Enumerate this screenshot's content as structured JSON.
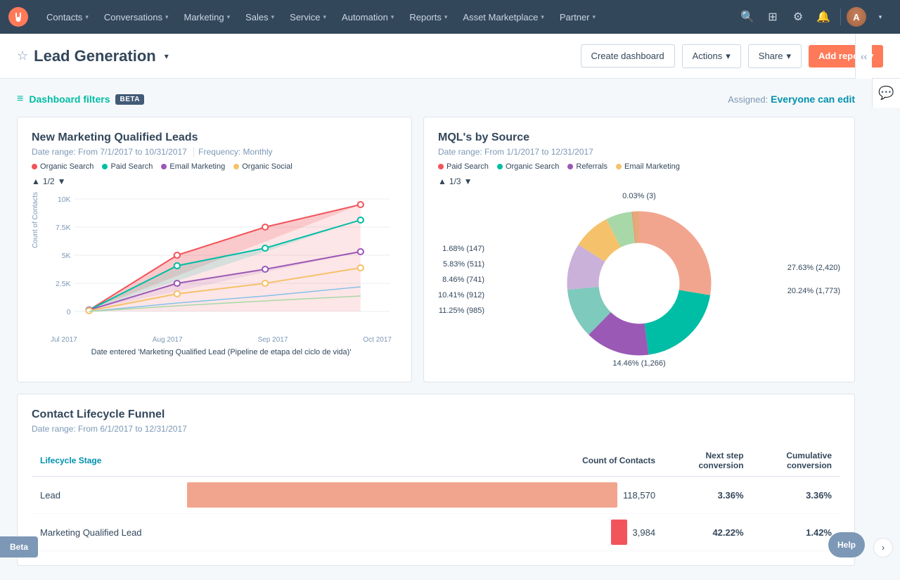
{
  "nav": {
    "logo_alt": "HubSpot",
    "items": [
      {
        "label": "Contacts",
        "id": "contacts"
      },
      {
        "label": "Conversations",
        "id": "conversations"
      },
      {
        "label": "Marketing",
        "id": "marketing"
      },
      {
        "label": "Sales",
        "id": "sales"
      },
      {
        "label": "Service",
        "id": "service"
      },
      {
        "label": "Automation",
        "id": "automation"
      },
      {
        "label": "Reports",
        "id": "reports"
      },
      {
        "label": "Asset Marketplace",
        "id": "asset-marketplace"
      },
      {
        "label": "Partner",
        "id": "partner"
      }
    ]
  },
  "header": {
    "title": "Lead Generation",
    "create_dashboard": "Create dashboard",
    "actions": "Actions",
    "share": "Share",
    "add_report": "Add report",
    "assigned_label": "Assigned:",
    "assigned_value": "Everyone can edit"
  },
  "filter_bar": {
    "label": "Dashboard filters",
    "beta": "BETA"
  },
  "chart_left": {
    "title": "New Marketing Qualified Leads",
    "date_range": "Date range: From 7/1/2017 to 10/31/2017",
    "frequency": "Frequency: Monthly",
    "y_axis_label": "Count of Contacts",
    "x_label": "Date entered 'Marketing Qualified Lead (Pipeline de etapa del ciclo de vida)'",
    "x_ticks": [
      "Jul 2017",
      "Aug 2017",
      "Sep 2017",
      "Oct 2017"
    ],
    "y_ticks": [
      "10K",
      "7.5K",
      "5K",
      "2.5K",
      "0"
    ],
    "pagination": "1/2",
    "legend": [
      {
        "label": "Organic Search",
        "color": "#f2545b"
      },
      {
        "label": "Paid Search",
        "color": "#00bda5"
      },
      {
        "label": "Email Marketing",
        "color": "#9b59b6"
      },
      {
        "label": "Organic Social",
        "color": "#f5c26b"
      }
    ]
  },
  "chart_right": {
    "title": "MQL's by Source",
    "date_range": "Date range: From 1/1/2017 to 12/31/2017",
    "pagination": "1/3",
    "legend": [
      {
        "label": "Paid Search",
        "color": "#f2545b"
      },
      {
        "label": "Organic Search",
        "color": "#00bda5"
      },
      {
        "label": "Referrals",
        "color": "#9b59b6"
      },
      {
        "label": "Email Marketing",
        "color": "#f5c26b"
      }
    ],
    "segments": [
      {
        "label": "27.63% (2,420)",
        "color": "#f2a58e",
        "position": "right-top"
      },
      {
        "label": "20.24% (1,773)",
        "color": "#00bda5",
        "position": "right-bottom"
      },
      {
        "label": "14.46% (1,266)",
        "color": "#9b59b6",
        "position": "bottom"
      },
      {
        "label": "11.25% (985)",
        "color": "#7ecabd",
        "position": "left-bottom"
      },
      {
        "label": "10.41% (912)",
        "color": "#c9b1d9",
        "position": "left"
      },
      {
        "label": "8.46% (741)",
        "color": "#f5c26b",
        "position": "left-upper"
      },
      {
        "label": "5.83% (511)",
        "color": "#a8d8a8",
        "position": "left-top"
      },
      {
        "label": "1.68% (147)",
        "color": "#e8a87c",
        "position": "top-left"
      },
      {
        "label": "0.03% (3)",
        "color": "#5a8a5a",
        "position": "top"
      }
    ]
  },
  "funnel": {
    "title": "Contact Lifecycle Funnel",
    "date_range": "Date range: From 6/1/2017 to 12/31/2017",
    "col_stage": "Lifecycle Stage",
    "col_count": "Count of Contacts",
    "col_next": "Next step conversion",
    "col_cumulative": "Cumulative conversion",
    "rows": [
      {
        "stage": "Lead",
        "count": 118570,
        "count_display": "118,570",
        "bar_width_pct": 100,
        "bar_color": "#f2a58e",
        "next_conversion": "3.36%",
        "cumulative_conversion": "3.36%"
      },
      {
        "stage": "Marketing Qualified Lead",
        "count": 3984,
        "count_display": "3,984",
        "bar_width_pct": 3.4,
        "bar_color": "#f2545b",
        "next_conversion": "42.22%",
        "cumulative_conversion": "1.42%"
      }
    ]
  },
  "beta_btn": "Beta",
  "help_btn": "Help"
}
